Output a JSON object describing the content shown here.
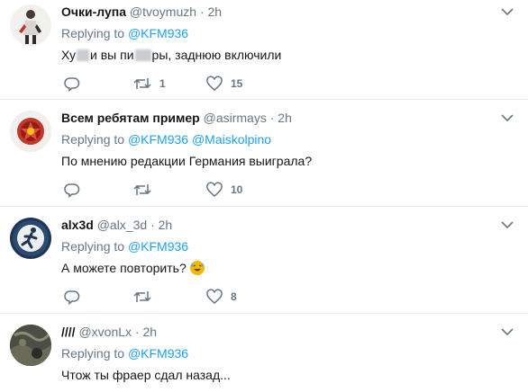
{
  "tweets": [
    {
      "name": "Очки-лупа",
      "handle": "@tvoymuzh",
      "time": "2h",
      "replying_label": "Replying to",
      "mentions": [
        "@KFM936"
      ],
      "text_parts": [
        "Ху",
        "и вы пи",
        "ры, заднюю включили"
      ],
      "retweets": "1",
      "likes": "15",
      "avatar": "figure-avatar"
    },
    {
      "name": "Всем ребятам пример",
      "handle": "@asirmays",
      "time": "2h",
      "replying_label": "Replying to",
      "mentions": [
        "@KFM936",
        "@Maiskolpino"
      ],
      "text": "По мнению редакции Германия выиграла?",
      "retweets": "",
      "likes": "10",
      "avatar": "red-star-avatar"
    },
    {
      "name": "alx3d",
      "handle": "@alx_3d",
      "time": "2h",
      "replying_label": "Replying to",
      "mentions": [
        "@KFM936"
      ],
      "text": "А можете повторить?",
      "retweets": "",
      "likes": "8",
      "avatar": "runner-sign-avatar"
    },
    {
      "name": "////",
      "handle": "@xvonLx",
      "time": "2h",
      "replying_label": "Replying to",
      "mentions": [
        "@KFM936"
      ],
      "text": "Чтож ты фраер сдал назад...",
      "avatar": "dark-photo-avatar"
    }
  ],
  "colors": {
    "link": "#1da1f2",
    "muted": "#657786",
    "divider": "#e6ecf0"
  }
}
